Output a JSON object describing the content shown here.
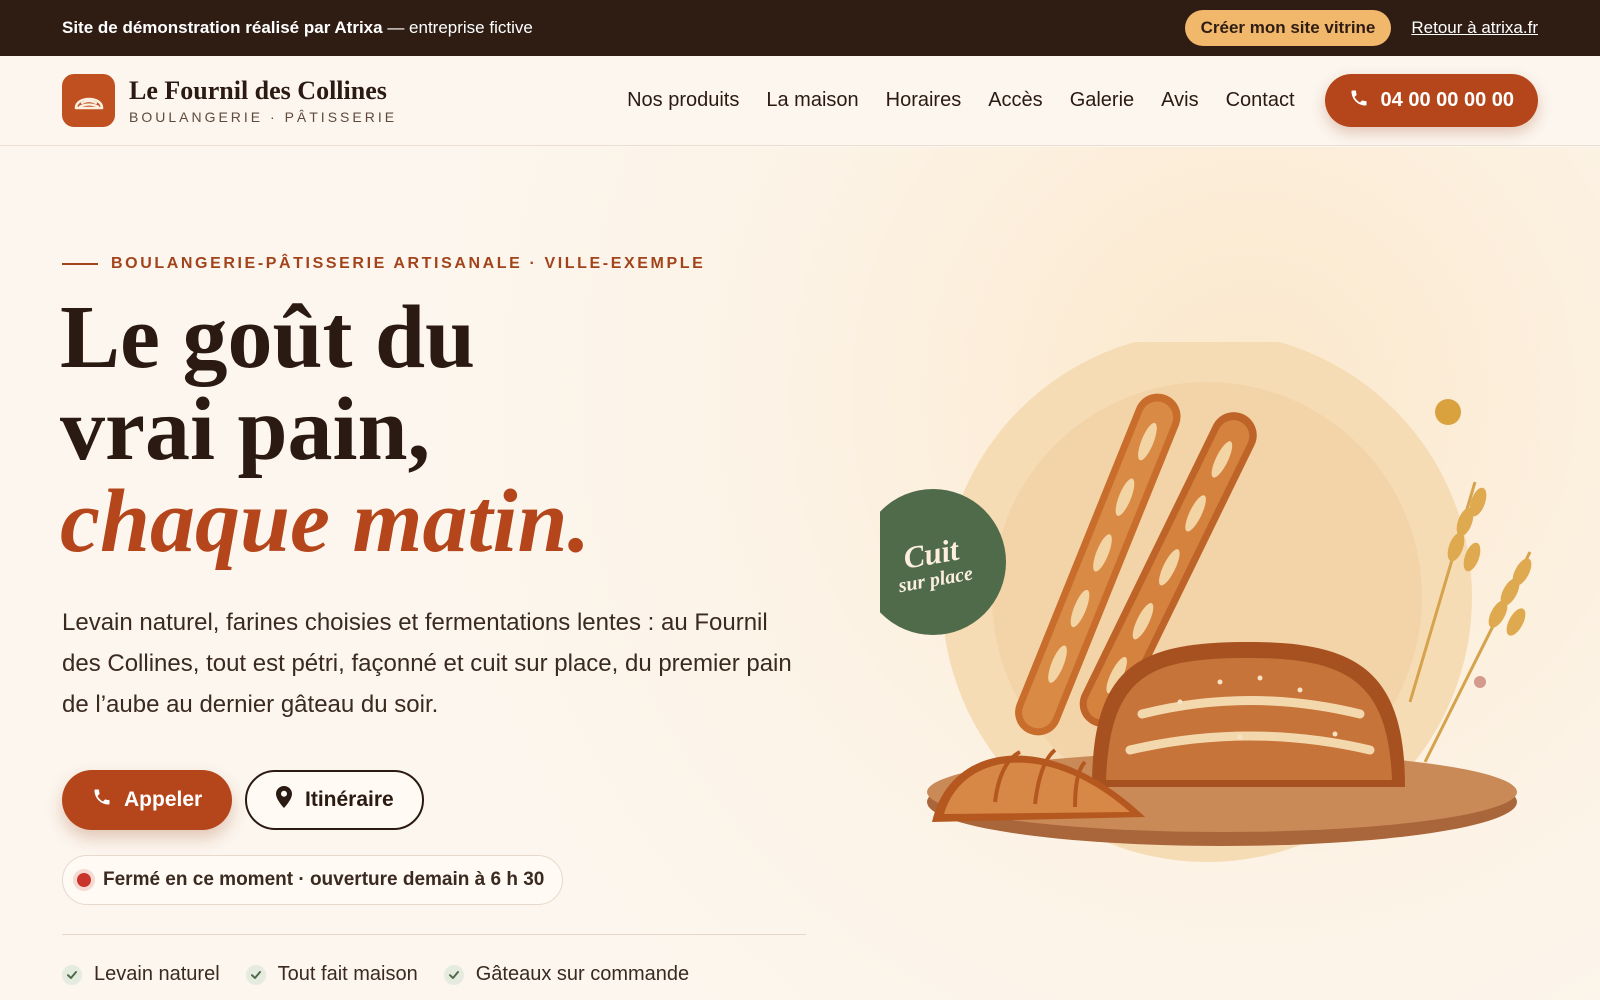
{
  "topbar": {
    "demo_strong": "Site de démonstration réalisé par Atrixa",
    "demo_rest": " — entreprise fictive",
    "cta": "Créer mon site vitrine",
    "back_link": "Retour à atrixa.fr"
  },
  "header": {
    "brand_name": "Le Fournil des Collines",
    "brand_tagline": "BOULANGERIE · PÂTISSERIE",
    "nav": [
      "Nos produits",
      "La maison",
      "Horaires",
      "Accès",
      "Galerie",
      "Avis",
      "Contact"
    ],
    "phone": "04 00 00 00 00"
  },
  "hero": {
    "eyebrow": "BOULANGERIE-PÂTISSERIE ARTISANALE · VILLE-EXEMPLE",
    "headline_line1": "Le goût du",
    "headline_line2": "vrai pain,",
    "headline_accent": "chaque matin.",
    "lede": "Levain naturel, farines choisies et fermentations lentes : au Fournil des Collines, tout est pétri, façonné et cuit sur place, du premier pain de l’aube au dernier gâteau du soir.",
    "btn_call": "Appeler",
    "btn_route": "Itinéraire",
    "status": "Fermé en ce moment · ouverture demain à 6 h 30",
    "features": [
      "Levain naturel",
      "Tout fait maison",
      "Gâteaux sur commande"
    ],
    "badge_line1": "Cuit",
    "badge_line2": "sur place"
  },
  "icons": {
    "logo": "bread-logo-icon",
    "phone": "phone-icon",
    "pin": "location-pin-icon",
    "check": "check-icon"
  },
  "colors": {
    "accent": "#b5461b",
    "dark": "#2f1d14",
    "banner_cta": "#f1b86b",
    "status_closed": "#c9352a",
    "badge_green": "#4f6b4a",
    "background": "#fcf6ee"
  }
}
